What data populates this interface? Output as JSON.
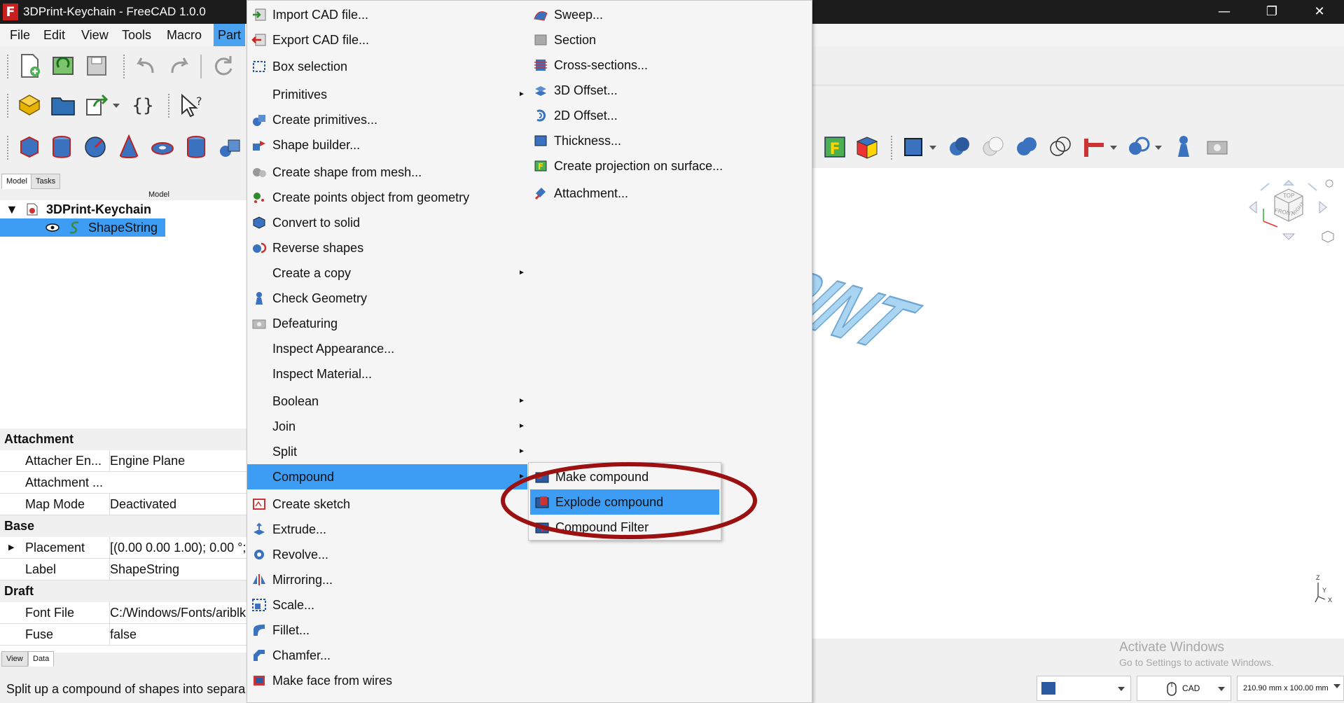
{
  "window": {
    "title": "3DPrint-Keychain - FreeCAD 1.0.0",
    "logo": "F",
    "minimize": "—",
    "maximize": "❐",
    "close": "✕"
  },
  "menubar": [
    "File",
    "Edit",
    "View",
    "Tools",
    "Macro",
    "Part"
  ],
  "panel": {
    "tabs": [
      "Model",
      "Tasks"
    ],
    "header": "Model",
    "doc": "3DPrint-Keychain",
    "object": "ShapeString",
    "bottom_tabs": [
      "View",
      "Data"
    ]
  },
  "properties": {
    "attachment": {
      "group": "Attachment",
      "rows": [
        {
          "name": "Attacher En...",
          "value": "Engine Plane"
        },
        {
          "name": "Attachment ...",
          "value": ""
        },
        {
          "name": "Map Mode",
          "value": "Deactivated"
        }
      ]
    },
    "base": {
      "group": "Base",
      "rows": [
        {
          "name": "Placement",
          "value": "[(0.00 0.00 1.00); 0.00 °; ("
        },
        {
          "name": "Label",
          "value": "ShapeString"
        }
      ]
    },
    "draft": {
      "group": "Draft",
      "rows": [
        {
          "name": "Font File",
          "value": "C:/Windows/Fonts/ariblk"
        },
        {
          "name": "Fuse",
          "value": "false"
        }
      ]
    }
  },
  "status": "Split up a compound of shapes into separa",
  "part_menu": {
    "items": [
      {
        "label": "Import CAD file...",
        "icon": "import-cad-icon"
      },
      {
        "label": "Export CAD file...",
        "icon": "export-cad-icon"
      },
      {
        "label": "Box selection",
        "icon": "box-selection-icon"
      },
      {
        "label": "Primitives",
        "submenu": true
      },
      {
        "label": "Create primitives...",
        "icon": "create-primitives-icon"
      },
      {
        "label": "Shape builder...",
        "icon": "shape-builder-icon"
      },
      {
        "label": "Create shape from mesh...",
        "icon": "shape-from-mesh-icon"
      },
      {
        "label": "Create points object from geometry",
        "icon": "points-object-icon"
      },
      {
        "label": "Convert to solid",
        "icon": "convert-solid-icon"
      },
      {
        "label": "Reverse shapes",
        "icon": "reverse-shapes-icon"
      },
      {
        "label": "Create a copy",
        "submenu": true
      },
      {
        "label": "Check Geometry",
        "icon": "check-geometry-icon"
      },
      {
        "label": "Defeaturing",
        "icon": "defeaturing-icon"
      },
      {
        "label": "Inspect Appearance...",
        "icon": ""
      },
      {
        "label": "Inspect Material...",
        "icon": ""
      },
      {
        "label": "Boolean",
        "submenu": true
      },
      {
        "label": "Join",
        "submenu": true
      },
      {
        "label": "Split",
        "submenu": true
      },
      {
        "label": "Compound",
        "submenu": true,
        "highlight": true
      },
      {
        "label": "Create sketch",
        "icon": "create-sketch-icon"
      },
      {
        "label": "Extrude...",
        "icon": "extrude-icon"
      },
      {
        "label": "Revolve...",
        "icon": "revolve-icon"
      },
      {
        "label": "Mirroring...",
        "icon": "mirroring-icon"
      },
      {
        "label": "Scale...",
        "icon": "scale-icon"
      },
      {
        "label": "Fillet...",
        "icon": "fillet-icon"
      },
      {
        "label": "Chamfer...",
        "icon": "chamfer-icon"
      },
      {
        "label": "Make face from wires",
        "icon": "face-from-wires-icon"
      }
    ],
    "col2": [
      {
        "label": "Sweep...",
        "icon": "sweep-icon"
      },
      {
        "label": "Section",
        "icon": "section-icon"
      },
      {
        "label": "Cross-sections...",
        "icon": "cross-sections-icon"
      },
      {
        "label": "3D Offset...",
        "icon": "offset-3d-icon"
      },
      {
        "label": "2D Offset...",
        "icon": "offset-2d-icon"
      },
      {
        "label": "Thickness...",
        "icon": "thickness-icon"
      },
      {
        "label": "Create projection on surface...",
        "icon": "projection-icon"
      },
      {
        "label": "Attachment...",
        "icon": "attachment-icon"
      }
    ]
  },
  "compound_menu": [
    {
      "label": "Make compound",
      "icon": "make-compound-icon"
    },
    {
      "label": "Explode compound",
      "icon": "explode-compound-icon",
      "highlight": true
    },
    {
      "label": "Compound Filter",
      "icon": "compound-filter-icon"
    }
  ],
  "viewport": {
    "text": "3DPRINT",
    "navcube": {
      "top": "TOP",
      "front": "FRONT",
      "right": "RIGHT"
    },
    "axes": {
      "z": "Z",
      "y": "Y",
      "x": "X"
    }
  },
  "watermark": {
    "title": "Activate Windows",
    "subtitle": "Go to Settings to activate Windows."
  },
  "statusbar": {
    "nav_style": "CAD",
    "dimensions": "210.90 mm x 100.00 mm"
  },
  "colors": {
    "highlight": "#3d9df5",
    "menu_active": "#4aa3f0",
    "annotation": "#9b1010",
    "text3d": "#a9d4f2"
  }
}
